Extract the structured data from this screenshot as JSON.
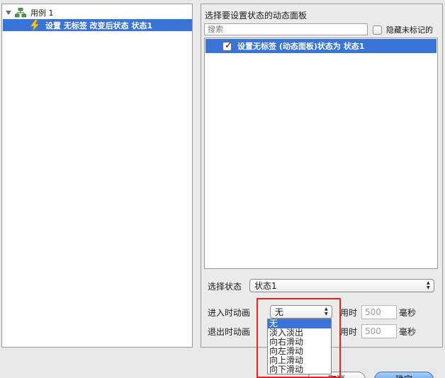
{
  "tree": {
    "case_label": "用例 1",
    "action_label": "设置 无标签 改变后状态 状态1"
  },
  "panel": {
    "heading": "选择要设置状态的动态面板",
    "search_placeholder": "搜索",
    "hide_unmarked_label": "隐藏未标记的",
    "list": [
      {
        "label": "设置无标签 (动态面板)状态为 状态1",
        "checked": true
      }
    ]
  },
  "state_select": {
    "label": "选择状态",
    "value": "状态1"
  },
  "enter_animation": {
    "label": "进入时动画",
    "value": "无",
    "duration_label": "用时",
    "duration": "500",
    "unit": "毫秒"
  },
  "exit_animation": {
    "label": "退出时动画",
    "duration_label": "用时",
    "duration": "500",
    "unit": "毫秒"
  },
  "animation_options": [
    "无",
    "淡入淡出",
    "向右滑动",
    "向左滑动",
    "向上滑动",
    "向下滑动"
  ],
  "buttons": {
    "cancel": "取消",
    "ok": "确定"
  },
  "colors": {
    "selection": "#3875d7",
    "highlight": "#e2261c"
  }
}
